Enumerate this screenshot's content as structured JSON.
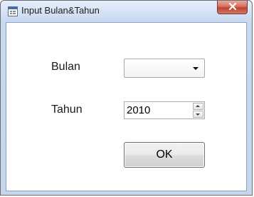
{
  "window": {
    "title": "Input Bulan&Tahun",
    "icon": "form-window-icon",
    "close_icon": "close-icon"
  },
  "form": {
    "bulan_label": "Bulan",
    "bulan_value": "",
    "tahun_label": "Tahun",
    "tahun_value": "2010",
    "ok_label": "OK"
  },
  "colors": {
    "close_button": "#c3422c",
    "titlebar": "#c8d8ef"
  }
}
